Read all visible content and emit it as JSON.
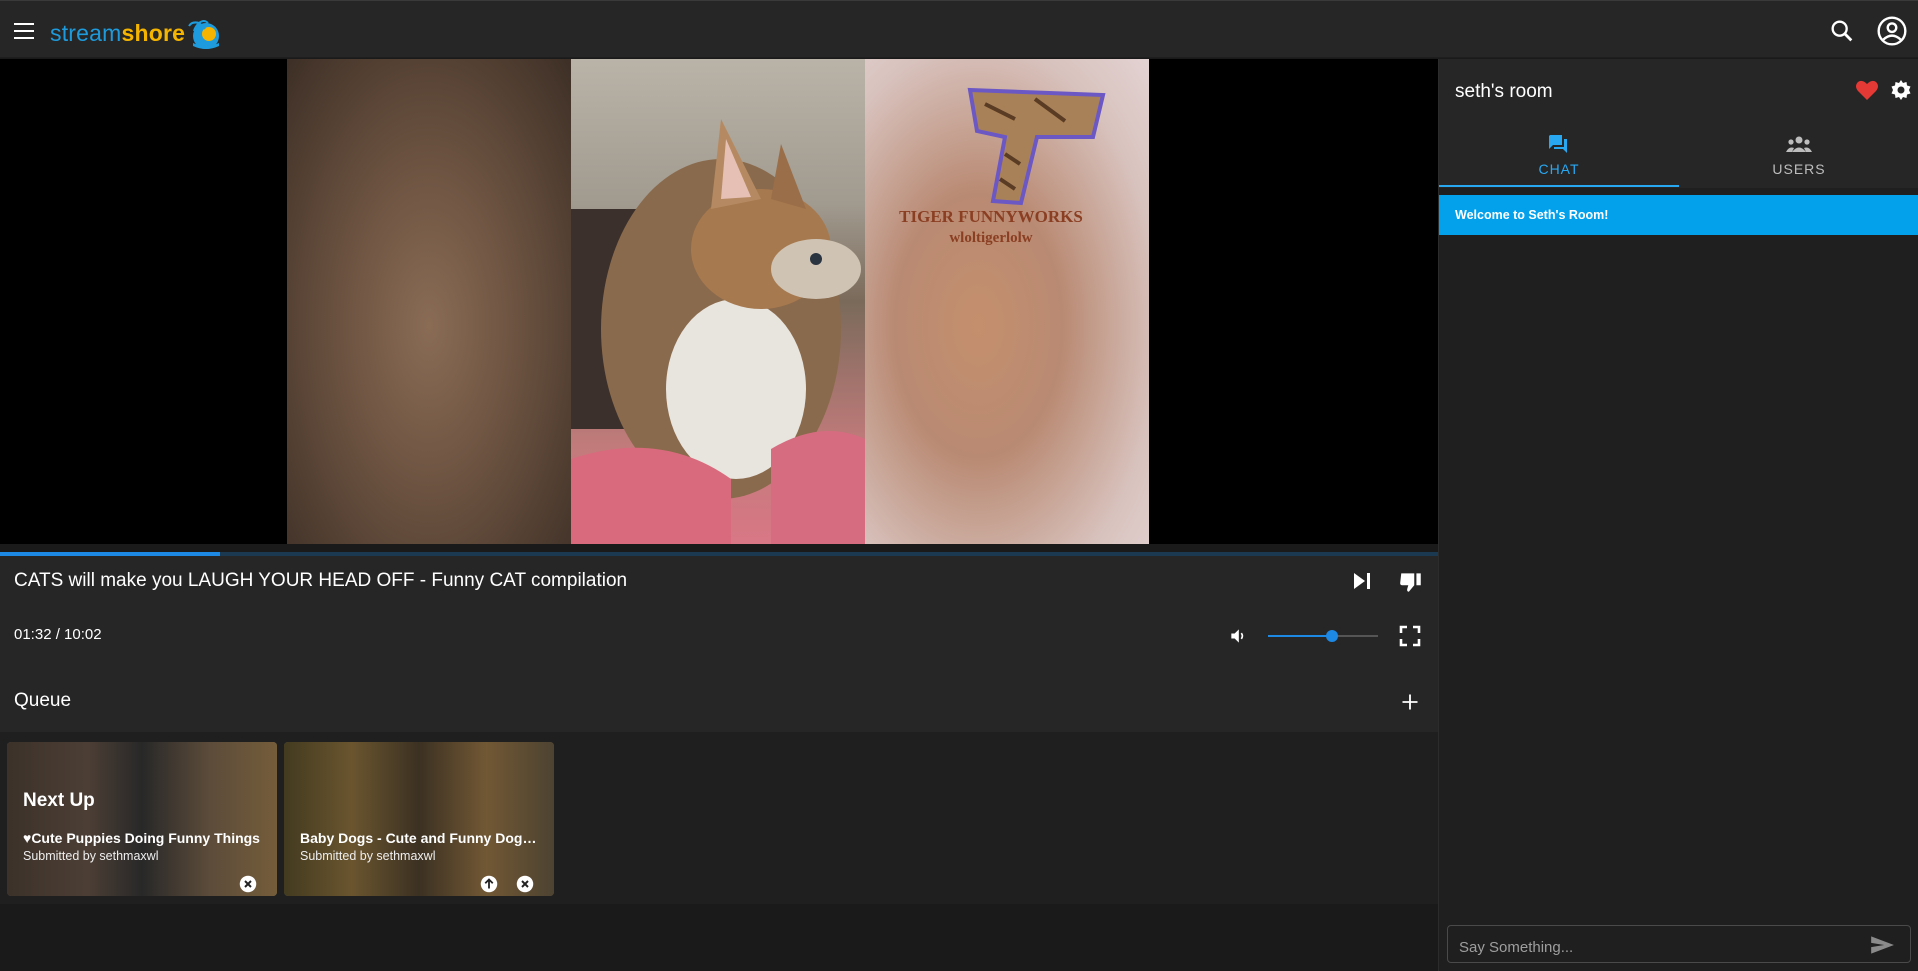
{
  "app": {
    "logo_part1": "stream",
    "logo_part2": "shore"
  },
  "video": {
    "title": "CATS will make you LAUGH YOUR HEAD OFF - Funny CAT compilation",
    "time_display": "01:32 / 10:02",
    "progress_fraction": 0.153,
    "volume_fraction": 0.58,
    "watermark_line1": "TIGER FUNNYWORKS",
    "watermark_line2": "wloltigerlolw"
  },
  "queue": {
    "title": "Queue",
    "items": [
      {
        "badge": "Next Up",
        "title": "♥Cute Puppies Doing Funny Things",
        "submitter": "Submitted by sethmaxwl"
      },
      {
        "badge": "",
        "title": "Baby Dogs - Cute and Funny Dog Videos",
        "submitter": "Submitted by sethmaxwl"
      }
    ]
  },
  "room": {
    "name": "seth's room",
    "tabs": [
      {
        "label": "CHAT",
        "icon": "chat-icon"
      },
      {
        "label": "USERS",
        "icon": "users-icon"
      }
    ],
    "welcome": "Welcome to Seth's Room!",
    "chat_placeholder": "Say Something..."
  },
  "colors": {
    "accent": "#1e88e5",
    "welcome_bg": "#03a0ec",
    "heart": "#e53935",
    "logo_blue": "#1e9bdc",
    "logo_yellow": "#f5b400"
  }
}
